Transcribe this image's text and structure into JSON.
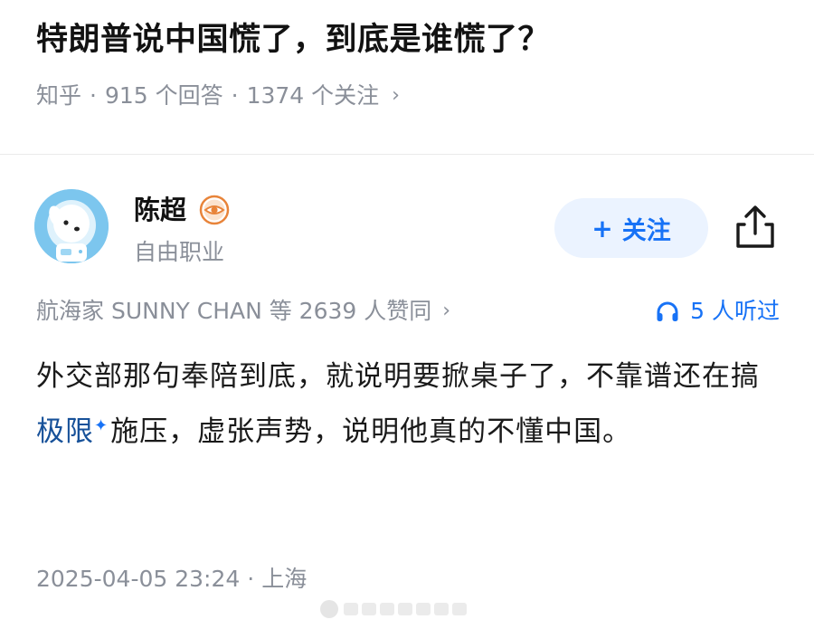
{
  "question": {
    "title": "特朗普说中国慌了，到底是谁慌了？",
    "site": "知乎",
    "answers": "915 个回答",
    "followers": "1374 个关注",
    "separator": "·",
    "chevron": "›"
  },
  "author": {
    "name": "陈超",
    "title": "自由职业",
    "badge_icon": "eye-badge-icon",
    "avatar_icon": "astronaut-dog-avatar"
  },
  "actions": {
    "follow_plus": "+",
    "follow_label": "关注",
    "share_icon": "share-icon"
  },
  "stats": {
    "agree_text": "航海家 SUNNY CHAN 等 2639 人赞同",
    "chevron": "›",
    "listen_text": "5 人听过",
    "listen_icon": "headphones-icon"
  },
  "answer": {
    "text_before": "外交部那句奉陪到底，就说明要掀桌子了，不靠谱还在搞",
    "keyword": "极限",
    "sparkle": "✦",
    "text_after": "施压，虚张声势，说明他真的不懂中国。"
  },
  "footer": {
    "date": "2025-04-05 23:24",
    "separator": "·",
    "location": "上海"
  },
  "colors": {
    "accent": "#1772f6",
    "meta_gray": "#8a8f99",
    "follow_bg": "#ebf3ff",
    "badge_orange": "#e8843a"
  }
}
